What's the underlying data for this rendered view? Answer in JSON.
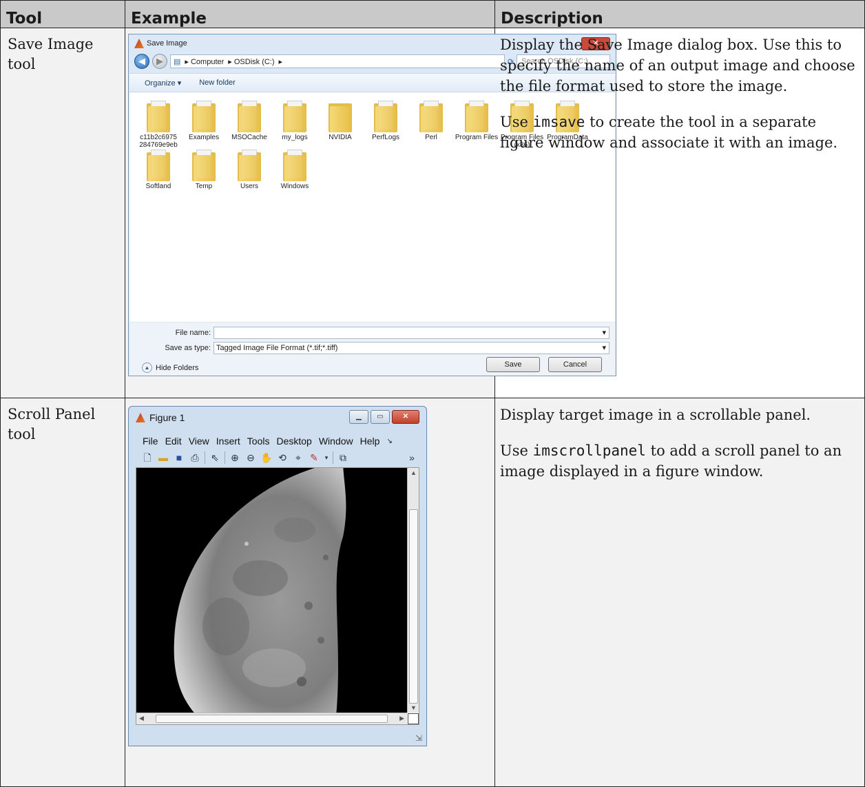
{
  "table": {
    "headers": [
      "Tool",
      "Example",
      "Description"
    ],
    "rows": [
      {
        "tool": "Save Image tool",
        "desc_p1": "Display the Save Image dialog box. Use this to specify the name of an output image and choose the file format used to store the image.",
        "desc_p2_pre": "Use ",
        "desc_p2_code": "imsave",
        "desc_p2_post": " to create the tool in a separate figure window and associate it with an image."
      },
      {
        "tool": "Scroll Panel tool",
        "desc_p1": "Display target image in a scrollable panel.",
        "desc_p2_pre": "Use ",
        "desc_p2_code": "imscrollpanel",
        "desc_p2_post": " to add a scroll panel to an image displayed in a figure window."
      }
    ]
  },
  "save_dialog": {
    "title": "Save Image",
    "breadcrumb": [
      "Computer",
      "OSDisk (C:)"
    ],
    "search_placeholder": "Search OSDisk (C:)",
    "organize": "Organize ▾",
    "new_folder": "New folder",
    "folders": [
      "c11b2c6975 284769e9eb",
      "Examples",
      "MSOCache",
      "my_logs",
      "NVIDIA",
      "PerfLogs",
      "Perl",
      "Program Files",
      "Program Files (x86)",
      "ProgramData",
      "Softland",
      "Temp",
      "Users",
      "Windows"
    ],
    "file_name_label": "File name:",
    "file_name_value": "",
    "save_type_label": "Save as type:",
    "save_type_value": "Tagged Image File Format (*.tif;*.tiff)",
    "hide_folders": "Hide Folders",
    "save_button": "Save",
    "cancel_button": "Cancel"
  },
  "figure_window": {
    "title": "Figure 1",
    "menu": [
      "File",
      "Edit",
      "View",
      "Insert",
      "Tools",
      "Desktop",
      "Window",
      "Help"
    ],
    "icons": [
      "new-file-icon",
      "open-folder-icon",
      "save-icon",
      "print-icon",
      "pointer-icon",
      "zoom-in-icon",
      "zoom-out-icon",
      "pan-icon",
      "rotate-icon",
      "data-cursor-icon",
      "brush-icon",
      "link-icon"
    ]
  }
}
